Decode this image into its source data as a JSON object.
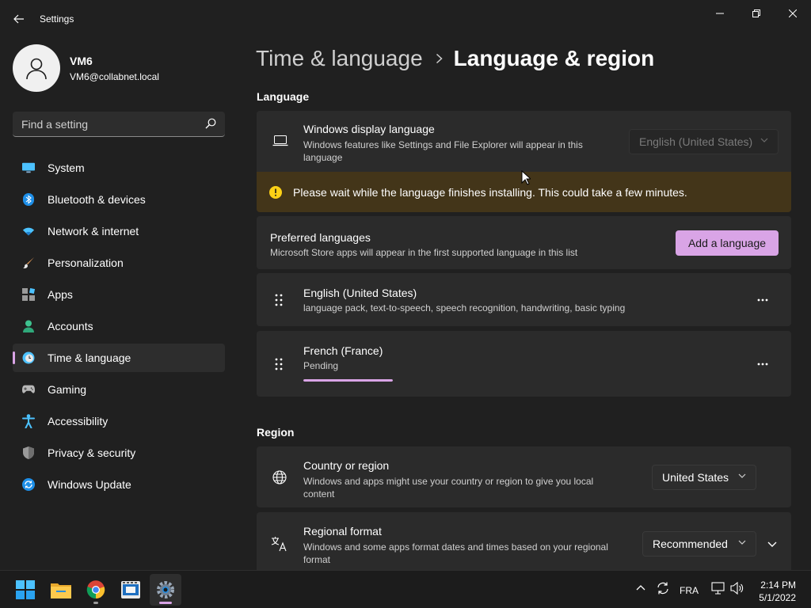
{
  "window": {
    "title": "Settings"
  },
  "profile": {
    "name": "VM6",
    "email": "VM6@collabnet.local"
  },
  "search": {
    "placeholder": "Find a setting"
  },
  "sidebar": {
    "items": [
      {
        "label": "System",
        "icon": "system-icon"
      },
      {
        "label": "Bluetooth & devices",
        "icon": "bluetooth-icon"
      },
      {
        "label": "Network & internet",
        "icon": "wifi-icon"
      },
      {
        "label": "Personalization",
        "icon": "brush-icon"
      },
      {
        "label": "Apps",
        "icon": "apps-icon"
      },
      {
        "label": "Accounts",
        "icon": "person-icon"
      },
      {
        "label": "Time & language",
        "icon": "clock-globe-icon",
        "active": true
      },
      {
        "label": "Gaming",
        "icon": "gamepad-icon"
      },
      {
        "label": "Accessibility",
        "icon": "accessibility-icon"
      },
      {
        "label": "Privacy & security",
        "icon": "shield-icon"
      },
      {
        "label": "Windows Update",
        "icon": "update-icon"
      }
    ]
  },
  "breadcrumb": {
    "parent": "Time & language",
    "current": "Language & region"
  },
  "language": {
    "section_title": "Language",
    "display_language": {
      "title": "Windows display language",
      "description": "Windows features like Settings and File Explorer will appear in this language",
      "value": "English (United States)"
    },
    "warning": "Please wait while the language finishes installing. This could take a few minutes.",
    "preferred": {
      "title": "Preferred languages",
      "description": "Microsoft Store apps will appear in the first supported language in this list",
      "add_button": "Add a language"
    },
    "installed": [
      {
        "name": "English (United States)",
        "detail": "language pack, text-to-speech, speech recognition, handwriting, basic typing"
      },
      {
        "name": "French (France)",
        "detail": "Pending"
      }
    ]
  },
  "region": {
    "section_title": "Region",
    "country": {
      "title": "Country or region",
      "description": "Windows and apps might use your country or region to give you local content",
      "value": "United States"
    },
    "format": {
      "title": "Regional format",
      "description": "Windows and some apps format dates and times based on your regional format",
      "value": "Recommended"
    }
  },
  "taskbar": {
    "apps": [
      "start-icon",
      "file-explorer-icon",
      "chrome-icon",
      "media-icon",
      "settings-icon"
    ],
    "tray": {
      "language": "FRA",
      "time": "2:14 PM",
      "date": "5/1/2022"
    }
  },
  "colors": {
    "accent": "#d9a4e6",
    "background": "#202020",
    "card": "#2b2b2b",
    "warning_bar": "#433519",
    "warning_icon": "#fcd116"
  }
}
